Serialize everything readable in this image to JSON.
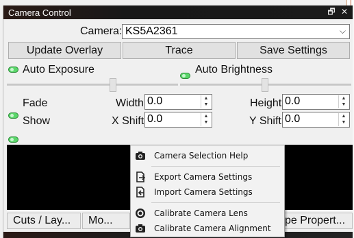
{
  "window": {
    "title": "Camera Control",
    "restore_glyph": "🗗",
    "close_glyph": "✕"
  },
  "camera": {
    "label": "Camera:",
    "selected": "KS5A2361"
  },
  "buttons": {
    "update_overlay": "Update Overlay",
    "trace": "Trace",
    "save_settings": "Save Settings"
  },
  "toggles": {
    "auto_exposure": "Auto Exposure",
    "auto_brightness": "Auto Brightness",
    "fade": "Fade",
    "show": "Show"
  },
  "sliders": {
    "exposure_level": 0.5,
    "brightness_level": 0.5
  },
  "fields": {
    "width_label": "Width",
    "width_value": "0.0",
    "height_label": "Height",
    "height_value": "0.0",
    "xshift_label": "X Shift",
    "xshift_value": "0.0",
    "yshift_label": "Y Shift",
    "yshift_value": "0.0"
  },
  "tabs": {
    "cuts": "Cuts / Lay...",
    "mo": "Mo...",
    "right": "pe Propert..."
  },
  "menu": {
    "items": [
      {
        "label": "Camera Selection Help",
        "icon": "camera-icon"
      },
      {
        "label": "Export Camera Settings",
        "icon": "export-icon"
      },
      {
        "label": "Import Camera Settings",
        "icon": "import-icon"
      },
      {
        "label": "Calibrate Camera Lens",
        "icon": "lens-icon"
      },
      {
        "label": "Calibrate Camera Alignment",
        "icon": "camera-icon"
      }
    ]
  },
  "colors": {
    "led_on": "#5ad66a",
    "titlebar": "#1a1a1a",
    "preview": "#000000"
  }
}
